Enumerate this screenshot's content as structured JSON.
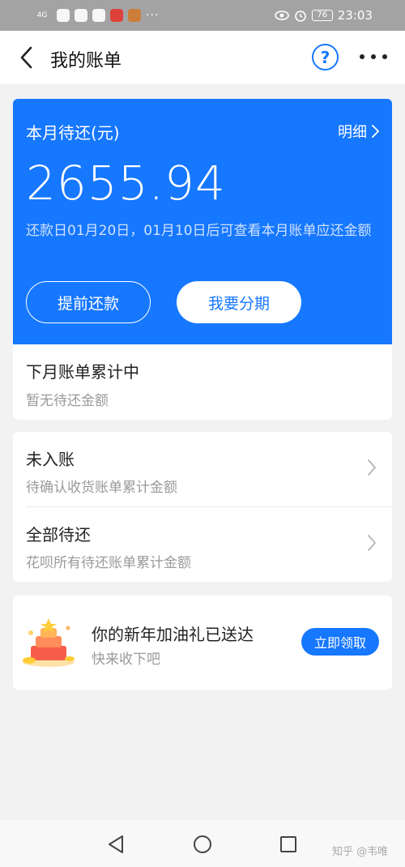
{
  "status_bar": {
    "network": "4G",
    "time": "23:03",
    "battery": "76",
    "more": "···"
  },
  "header": {
    "title": "我的账单",
    "help": "?"
  },
  "bill": {
    "label": "本月待还(元)",
    "detail_link": "明细",
    "amount": "2655.94",
    "due_note": "还款日01月20日，01月10日后可查看本月账单应还金额",
    "prepay_button": "提前还款",
    "installment_button": "我要分期"
  },
  "next_month": {
    "title": "下月账单累计中",
    "subtitle": "暂无待还金额"
  },
  "list": [
    {
      "title": "未入账",
      "subtitle": "待确认收货账单累计金额"
    },
    {
      "title": "全部待还",
      "subtitle": "花呗所有待还账单累计金额"
    }
  ],
  "promo": {
    "title": "你的新年加油礼已送达",
    "subtitle": "快来收下吧",
    "button": "立即领取"
  },
  "watermark": "知乎 @韦唯",
  "colors": {
    "accent": "#1677ff",
    "status_bar": "#a3a3a3"
  }
}
